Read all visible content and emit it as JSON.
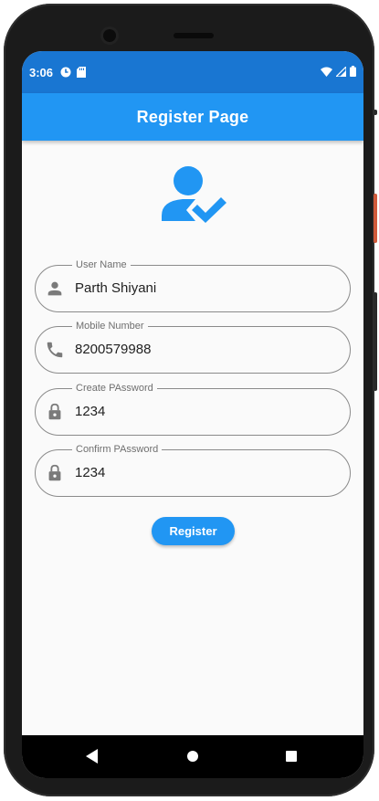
{
  "status_bar": {
    "time": "3:06"
  },
  "app_bar": {
    "title": "Register Page"
  },
  "header_icon": "person-check-icon",
  "fields": [
    {
      "label": "User Name",
      "value": "Parth Shiyani",
      "icon": "person-icon"
    },
    {
      "label": "Mobile Number",
      "value": "8200579988",
      "icon": "phone-icon"
    },
    {
      "label": "Create PAssword",
      "value": "1234",
      "icon": "lock-icon"
    },
    {
      "label": "Confirm PAssword",
      "value": "1234",
      "icon": "lock-icon"
    }
  ],
  "register_button": {
    "label": "Register"
  },
  "colors": {
    "status_bar": "#1976d2",
    "primary": "#2196f3",
    "background": "#fafafa",
    "field_border": "#8a8a8a"
  },
  "nav_bar": {
    "back": "back-triangle-icon",
    "home": "home-circle-icon",
    "recents": "recents-square-icon"
  }
}
